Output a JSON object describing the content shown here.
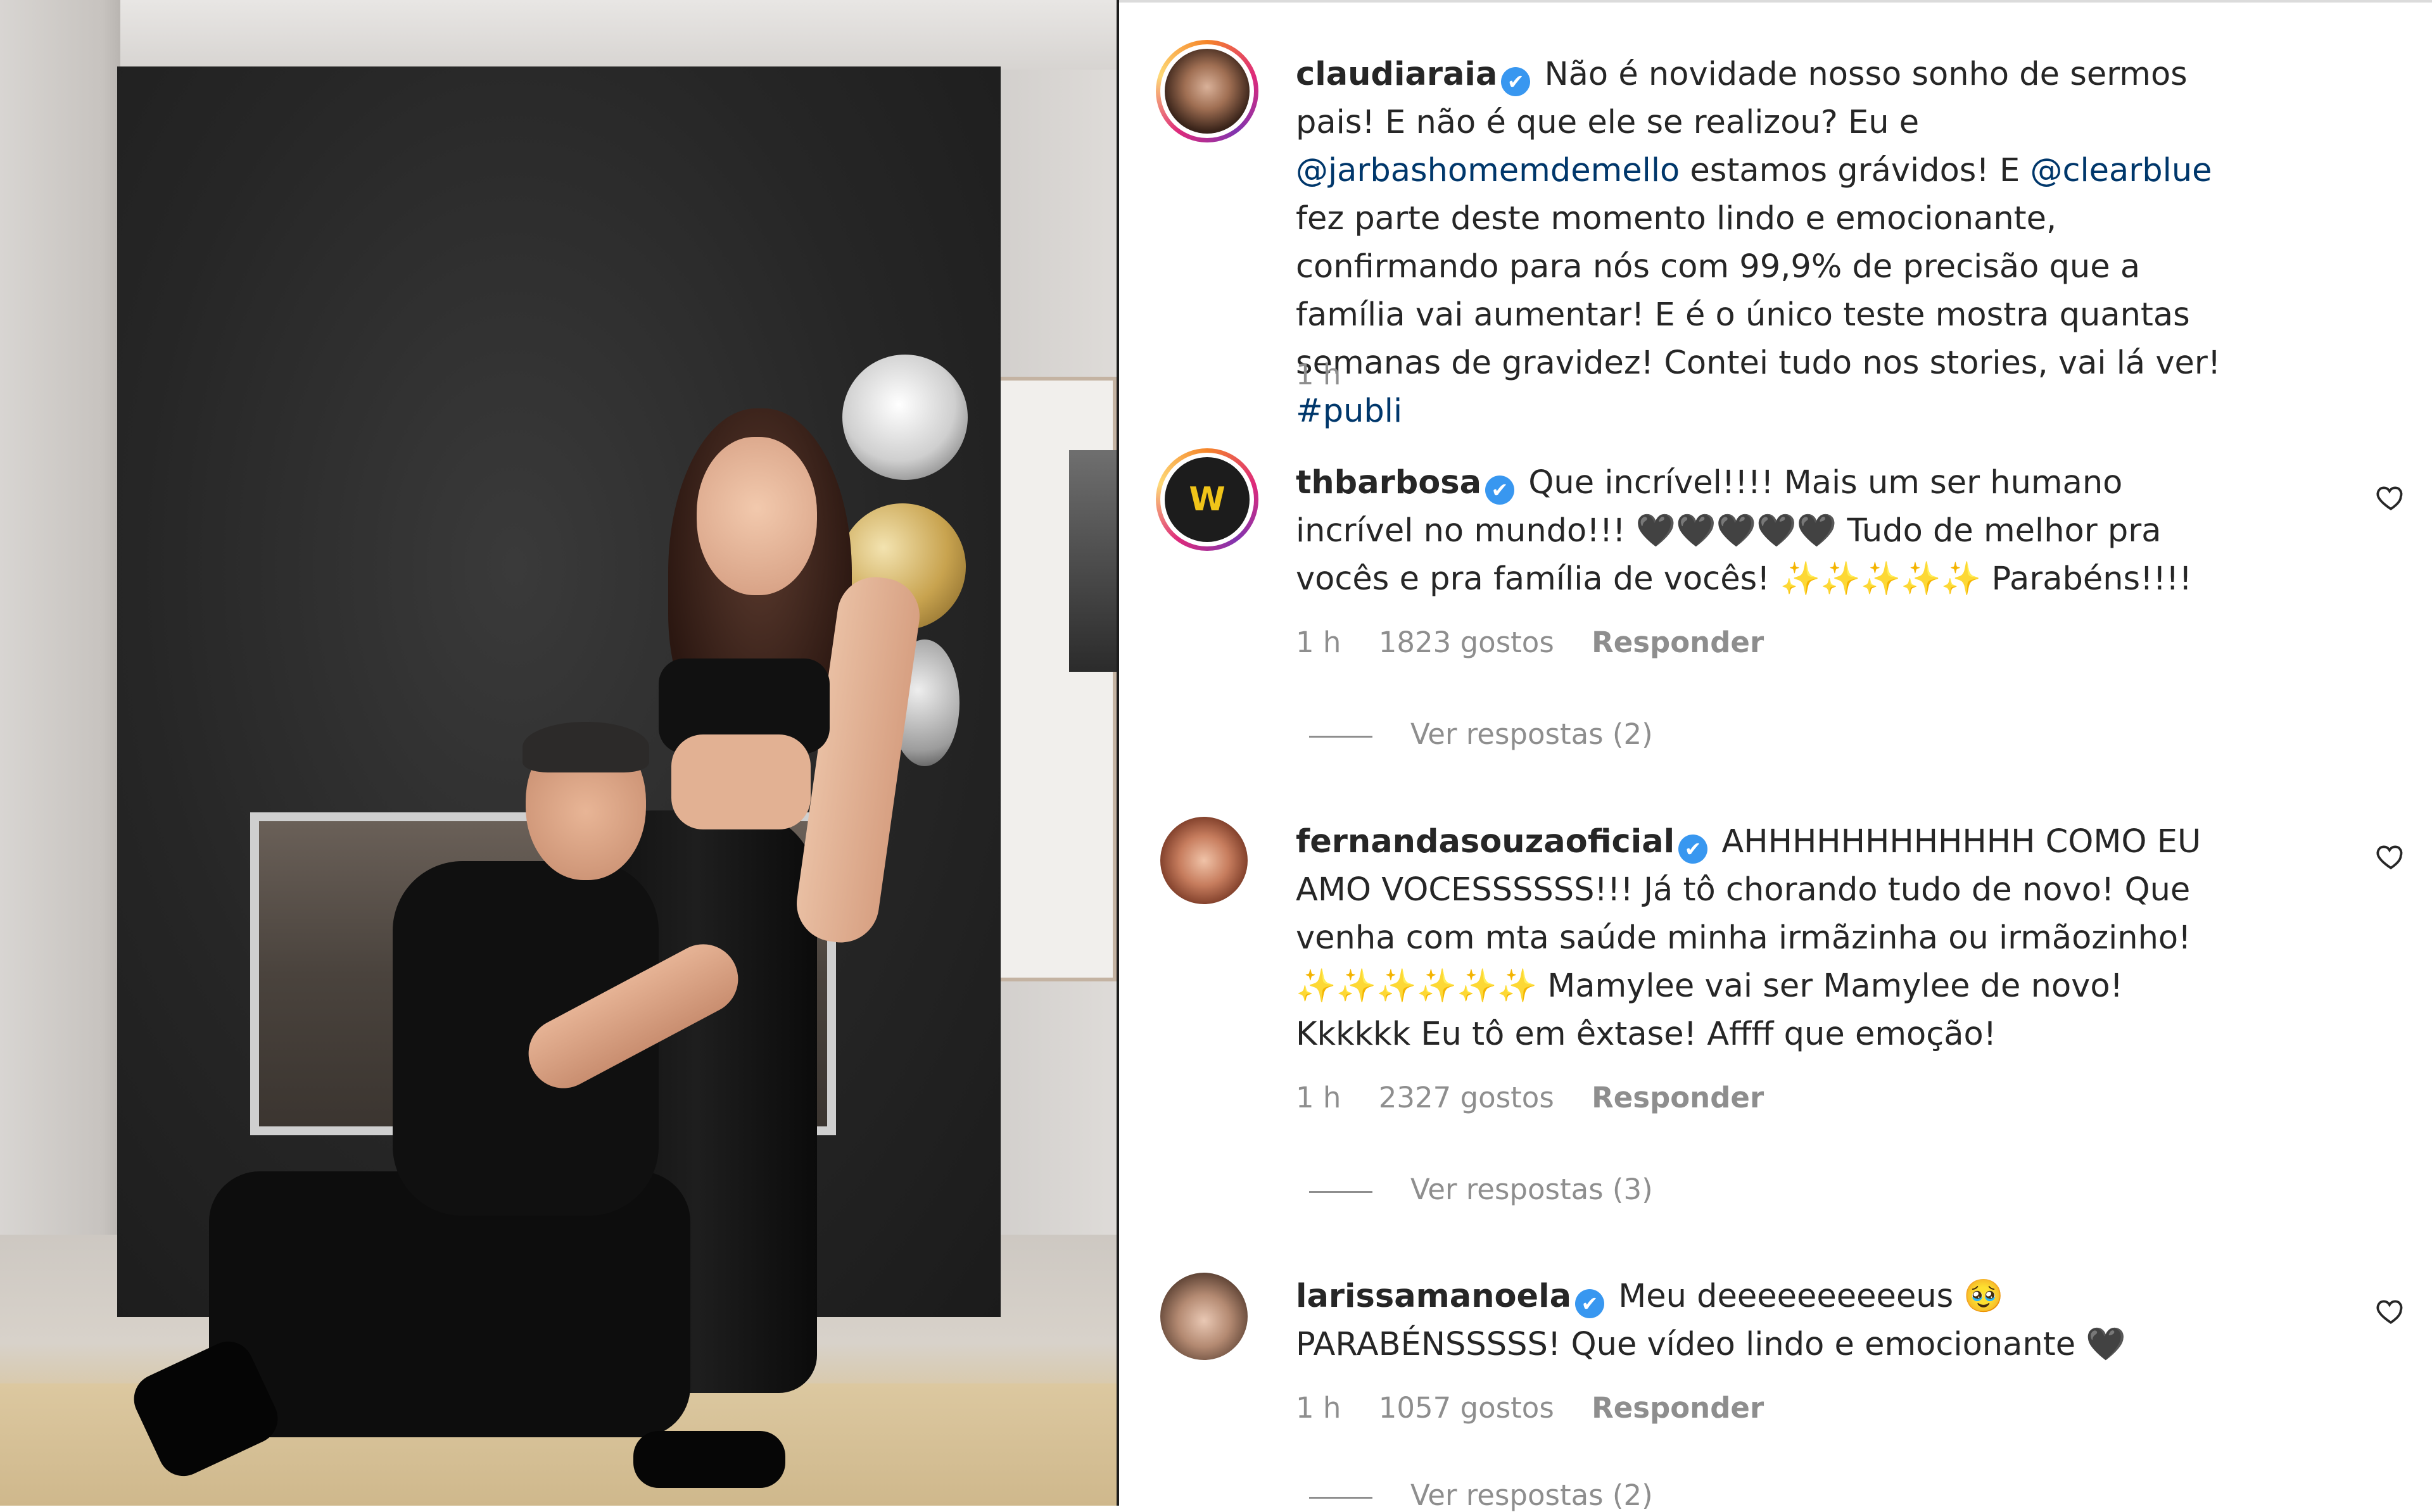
{
  "post": {
    "caption": {
      "username": "claudiaraia",
      "verified_mark": "✔",
      "text_before": " Não é novidade nosso sonho de sermos pais! E não é que ele se realizou? Eu e ",
      "mention1": "@jarbashomemdemello",
      "text_middle": " estamos grávidos! E ",
      "mention2": "@clearblue",
      "text_after": " fez parte deste momento lindo e emocionante, confirmando para nós com 99,9% de precisão que a família vai aumentar! E é o único teste mostra quantas semanas de gravidez! Contei tudo nos stories, vai lá ver! ",
      "hashtag": "#publi",
      "time": "1 h"
    }
  },
  "comments": [
    {
      "username": "thbarbosa",
      "text": " Que incrível!!!! Mais um ser humano incrível no mundo!!! 🖤🖤🖤🖤🖤 Tudo de melhor pra vocês e pra família de vocês! ✨✨✨✨✨ Parabéns!!!!",
      "time": "1 h",
      "likes": "1823 gostos",
      "reply_label": "Responder",
      "view_replies": "Ver respostas (2)",
      "avatar_text": "W"
    },
    {
      "username": "fernandasouzaoficial",
      "text": " AHHHHHHHHHHHH COMO EU AMO VOCESSSSSS!!! Já tô chorando tudo de novo! Que venha com mta saúde minha irmãzinha ou irmãozinho! ✨✨✨✨✨✨ Mamylee vai ser Mamylee de novo! Kkkkkk Eu tô em êxtase! Affff que emoção!",
      "time": "1 h",
      "likes": "2327 gostos",
      "reply_label": "Responder",
      "view_replies": "Ver respostas (3)"
    },
    {
      "username": "larissamanoela",
      "text": " Meu deeeeeeeeeeus 🥹 PARABÉNSSSSS! Que vídeo lindo e emocionante 🖤",
      "time": "1 h",
      "likes": "1057 gostos",
      "reply_label": "Responder",
      "view_replies": "Ver respostas (2)"
    }
  ],
  "colors": {
    "mention": "#00376b",
    "verified": "#3897f0",
    "meta": "#8e8e8e"
  }
}
